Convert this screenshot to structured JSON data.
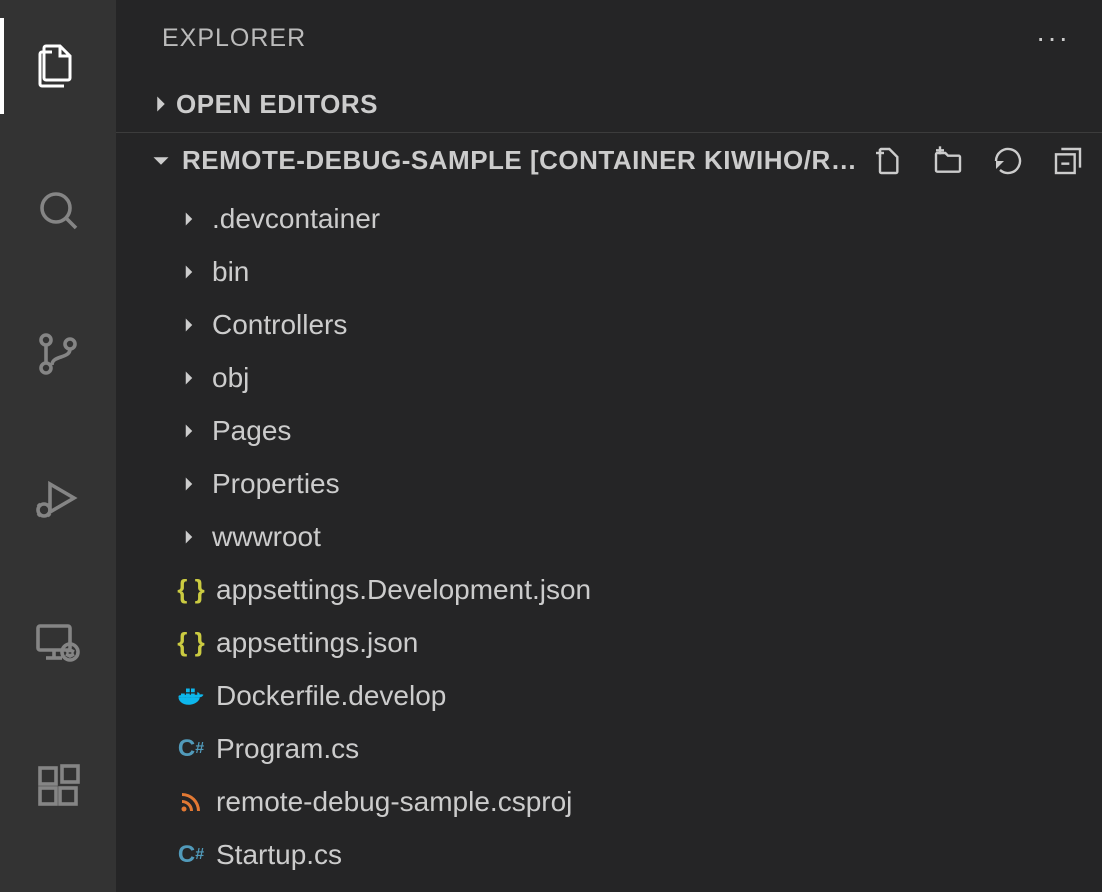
{
  "sidebar": {
    "title": "EXPLORER",
    "sections": {
      "open_editors": {
        "label": "OPEN EDITORS"
      },
      "workspace": {
        "label": "REMOTE-DEBUG-SAMPLE [CONTAINER KIWIHO/R…"
      }
    }
  },
  "tree": {
    "folders": [
      ".devcontainer",
      "bin",
      "Controllers",
      "obj",
      "Pages",
      "Properties",
      "wwwroot"
    ],
    "files": [
      {
        "name": "appsettings.Development.json",
        "icon": "json"
      },
      {
        "name": "appsettings.json",
        "icon": "json"
      },
      {
        "name": "Dockerfile.develop",
        "icon": "docker"
      },
      {
        "name": "Program.cs",
        "icon": "cs"
      },
      {
        "name": "remote-debug-sample.csproj",
        "icon": "rss"
      },
      {
        "name": "Startup.cs",
        "icon": "cs"
      }
    ]
  }
}
